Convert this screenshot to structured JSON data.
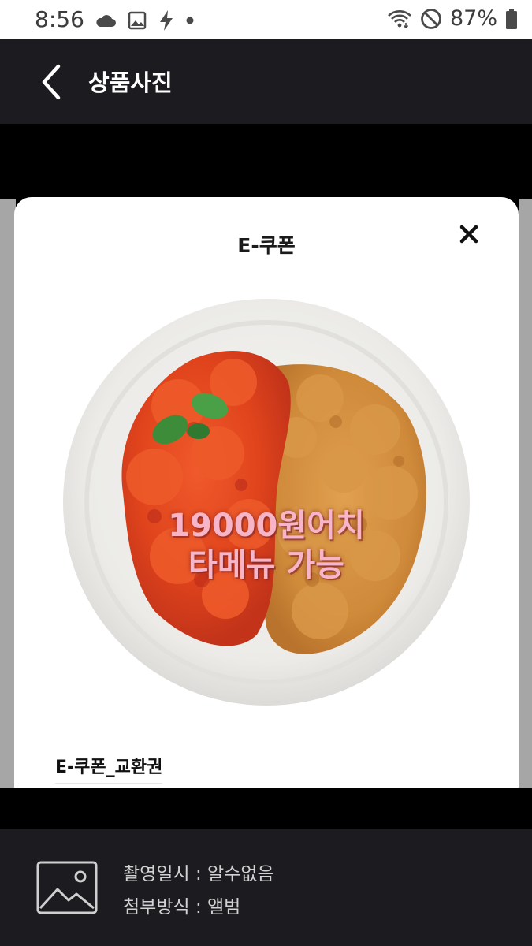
{
  "status_bar": {
    "time": "8:56",
    "battery_percent": "87%",
    "left_icons": [
      "cloud-icon",
      "image-icon",
      "flash-icon",
      "dot-icon"
    ],
    "right_icons": [
      "wifi-icon",
      "do-not-disturb-icon",
      "battery-icon"
    ]
  },
  "app_bar": {
    "title": "상품사진",
    "back_icon": "chevron-left-icon"
  },
  "card": {
    "title": "E-쿠폰",
    "close_icon": "close-icon",
    "promo_line1": "19000원어치",
    "promo_line2": "타메뉴 가능",
    "coupon_name": "E-쿠폰_교환권"
  },
  "info": {
    "icon": "image-placeholder-icon",
    "shot_date": "촬영일시 : 알수없음",
    "attach_method": "첨부방식 : 앨범"
  },
  "colors": {
    "app_bar_bg": "#1c1c20",
    "status_bar_bg": "#ffffff",
    "promo_text": "#f6b5c8"
  }
}
